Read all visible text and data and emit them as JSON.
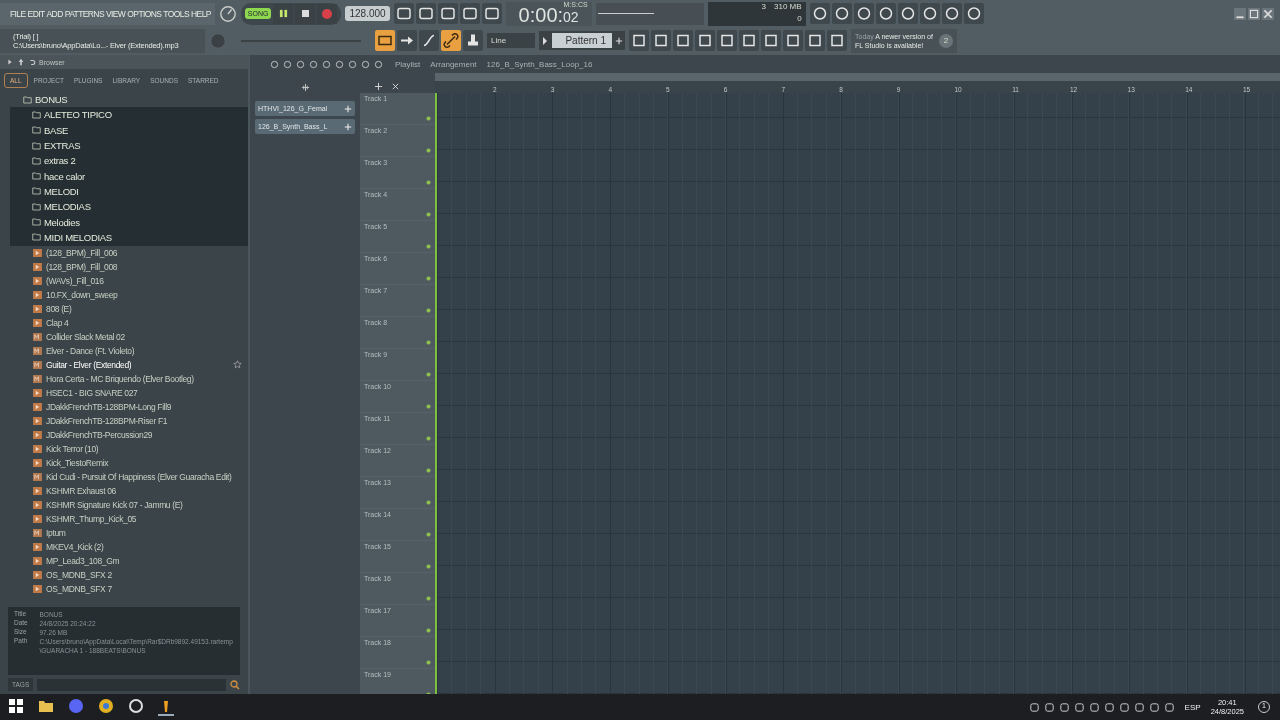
{
  "menu": [
    "FILE",
    "EDIT",
    "ADD",
    "PATTERNS",
    "VIEW",
    "OPTIONS",
    "TOOLS",
    "HELP"
  ],
  "hint": {
    "line1": "(Trial) [  ]",
    "line2": "C:\\Users\\bruno\\AppData\\Lo...- Elver (Extended).mp3"
  },
  "transport": {
    "mode": "SONG",
    "song_mode": true,
    "playing": true,
    "tempo": "128.000",
    "time_main": "0:00:",
    "time_cs": "02",
    "time_unit": "M:S:CS"
  },
  "monitor": {
    "cpu": "3",
    "memory": "310 MB",
    "polyphony": "0"
  },
  "snap": "Line",
  "pattern": "Pattern 1",
  "news": {
    "when": "Today",
    "text": "A newer version of FL Studio is available!",
    "count": "2"
  },
  "browser": {
    "title": "Browser",
    "tabs": [
      {
        "label": "ALL",
        "selected": true
      },
      {
        "label": "PROJECT",
        "selected": false
      },
      {
        "label": "PLUGINS",
        "selected": false
      },
      {
        "label": "LIBRARY",
        "selected": false
      },
      {
        "label": "SOUNDS",
        "selected": false
      },
      {
        "label": "STARRED",
        "selected": false
      }
    ],
    "root": "BONUS",
    "folders": [
      "ALETEO TIPICO",
      "BASE",
      "EXTRAS",
      "extras 2",
      "hace calor",
      "MELODI",
      "MELODIAS",
      "Melodies",
      "MIDI MELODIAS"
    ],
    "files": [
      {
        "name": "(128_BPM)_Fill_006",
        "kind": "audio",
        "hovered": false
      },
      {
        "name": "(128_BPM)_Fill_008",
        "kind": "audio",
        "hovered": false
      },
      {
        "name": "(WAVs)_Fill_016",
        "kind": "audio",
        "hovered": false
      },
      {
        "name": "10.FX_down_sweep",
        "kind": "audio",
        "hovered": false
      },
      {
        "name": "808 (E)",
        "kind": "audio",
        "hovered": false
      },
      {
        "name": "Clap 4",
        "kind": "audio",
        "hovered": false
      },
      {
        "name": "Collider Slack Metal 02",
        "kind": "mp3",
        "hovered": false
      },
      {
        "name": "Elver - Dance (Ft. Violeto)",
        "kind": "mp3",
        "hovered": false
      },
      {
        "name": "Guitar - Elver (Extended)",
        "kind": "mp3",
        "hovered": true
      },
      {
        "name": "Hora Certa - MC Briquendo (Elver Bootleg)",
        "kind": "mp3",
        "hovered": false
      },
      {
        "name": "HSEC1 - BIG SNARE 027",
        "kind": "audio",
        "hovered": false
      },
      {
        "name": "JDakkFrenchTB-128BPM-Long Fill9",
        "kind": "audio",
        "hovered": false
      },
      {
        "name": "JDakkFrenchTB-128BPM-Riser F1",
        "kind": "audio",
        "hovered": false
      },
      {
        "name": "JDakkFrenchTB-Percussion29",
        "kind": "audio",
        "hovered": false
      },
      {
        "name": "Kick Terror (10)",
        "kind": "audio",
        "hovered": false
      },
      {
        "name": "Kick_TiestoRemix",
        "kind": "audio",
        "hovered": false
      },
      {
        "name": "Kid Cudi - Pursuit Of Happiness (Elver Guaracha Edit)",
        "kind": "mp3",
        "hovered": false
      },
      {
        "name": "KSHMR Exhaust 06",
        "kind": "audio",
        "hovered": false
      },
      {
        "name": "KSHMR Signature Kick 07 - Jammu (E)",
        "kind": "audio",
        "hovered": false
      },
      {
        "name": "KSHMR_Thump_Kick_05",
        "kind": "audio",
        "hovered": false
      },
      {
        "name": "Iptum",
        "kind": "mp3",
        "hovered": false
      },
      {
        "name": "MKEV4_Kick (2)",
        "kind": "audio",
        "hovered": false
      },
      {
        "name": "MP_Lead3_108_Gm",
        "kind": "audio",
        "hovered": false
      },
      {
        "name": "OS_MDNB_SFX 2",
        "kind": "audio",
        "hovered": false
      },
      {
        "name": "OS_MDNB_SFX 7",
        "kind": "audio",
        "hovered": false
      }
    ],
    "info": [
      {
        "label": "Title",
        "value": "BONUS"
      },
      {
        "label": "Date",
        "value": "24/8/2025 20:24:22"
      },
      {
        "label": "Size",
        "value": "97.26 MB"
      },
      {
        "label": "Path",
        "value": "C:\\Users\\bruno\\AppData\\Local\\Temp\\Rar$DRb9892.49153.rartemp\\GUARACHA 1 - 188BEATS\\BONUS"
      }
    ],
    "tags": "TAGS"
  },
  "playlist": {
    "breadcrumb": [
      "Playlist",
      "Arrangement",
      "126_B_Synth_Bass_Loop_16"
    ],
    "clips": [
      "HTHVI_126_G_Femal",
      "126_B_Synth_Bass_L"
    ],
    "bars": [
      "2",
      "3",
      "4",
      "5",
      "6",
      "7",
      "8",
      "9",
      "10",
      "11",
      "12",
      "13",
      "14",
      "15"
    ],
    "tracks": [
      "Track 1",
      "Track 2",
      "Track 3",
      "Track 4",
      "Track 5",
      "Track 6",
      "Track 7",
      "Track 8",
      "Track 9",
      "Track 10",
      "Track 11",
      "Track 12",
      "Track 13",
      "Track 14",
      "Track 15",
      "Track 16",
      "Track 17",
      "Track 18",
      "Track 19"
    ]
  },
  "taskbar": {
    "language": "ESP",
    "time": "20:41",
    "date": "24/8/2025",
    "notifications": "1"
  }
}
